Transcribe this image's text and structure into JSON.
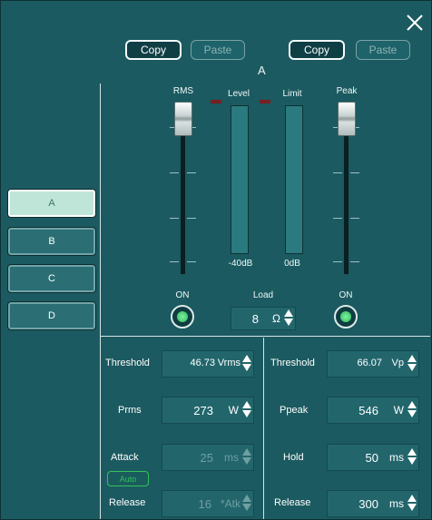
{
  "toolbar": {
    "copy_left": "Copy",
    "paste_left": "Paste",
    "copy_right": "Copy",
    "paste_right": "Paste"
  },
  "channel_title": "A",
  "faders": {
    "rms_label": "RMS",
    "peak_label": "Peak"
  },
  "meters": {
    "level_label": "Level",
    "limit_label": "Limit",
    "level_floor": "-40dB",
    "limit_floor": "0dB"
  },
  "channels": [
    "A",
    "B",
    "C",
    "D"
  ],
  "rms_on": "ON",
  "peak_on": "ON",
  "load": {
    "label": "Load",
    "value": "8",
    "unit": "Ω"
  },
  "rms_section": {
    "threshold": {
      "label": "Threshold",
      "value": "46.73",
      "unit": "Vrms"
    },
    "prms": {
      "label": "Prms",
      "value": "273",
      "unit": "W"
    },
    "attack": {
      "label": "Attack",
      "value": "25",
      "unit": "ms"
    },
    "auto": "Auto",
    "release": {
      "label": "Release",
      "value": "16",
      "unit": "*Atk"
    }
  },
  "peak_section": {
    "threshold": {
      "label": "Threshold",
      "value": "66.07",
      "unit": "Vp"
    },
    "ppeak": {
      "label": "Ppeak",
      "value": "546",
      "unit": "W"
    },
    "hold": {
      "label": "Hold",
      "value": "50",
      "unit": "ms"
    },
    "release": {
      "label": "Release",
      "value": "300",
      "unit": "ms"
    }
  },
  "colors": {
    "background": "#1b5a60",
    "on_indicator": "#2fb95b",
    "active_channel": "#bfe5d9"
  }
}
